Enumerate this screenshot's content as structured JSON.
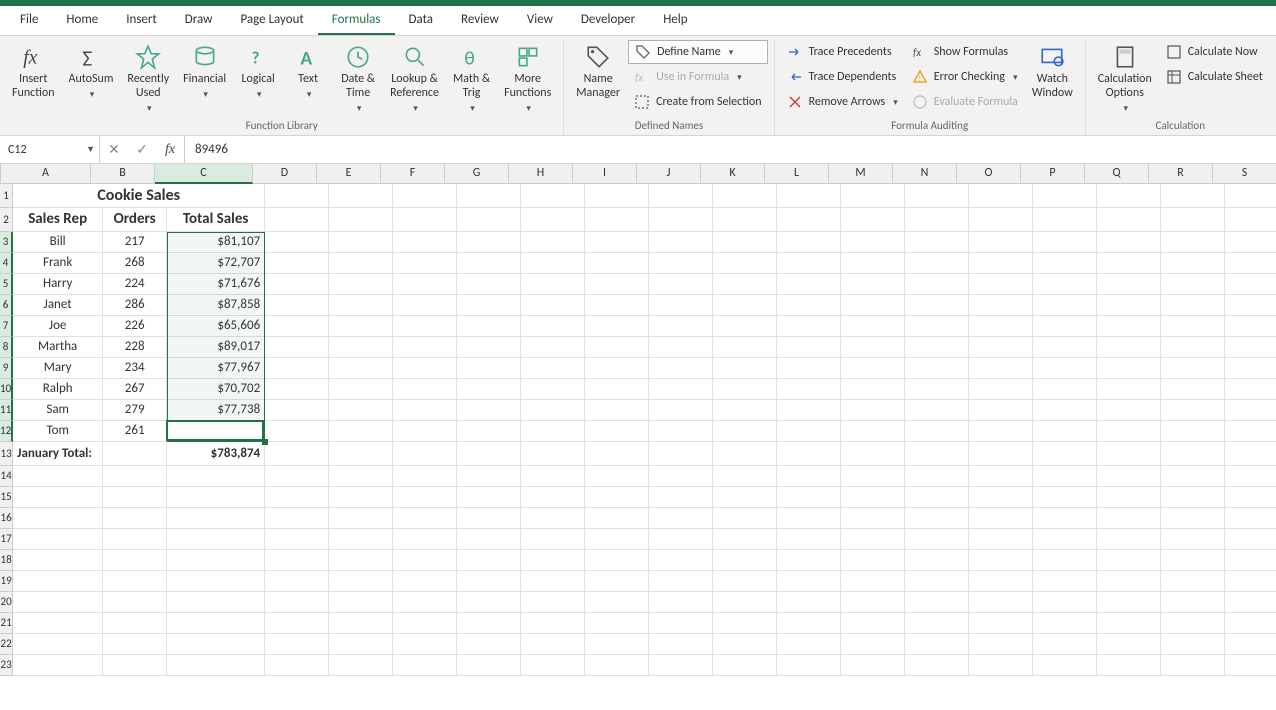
{
  "menu": {
    "tabs": [
      "File",
      "Home",
      "Insert",
      "Draw",
      "Page Layout",
      "Formulas",
      "Data",
      "Review",
      "View",
      "Developer",
      "Help"
    ],
    "active": "Formulas"
  },
  "ribbon": {
    "groups": {
      "fnlib": {
        "label": "Function Library",
        "insert_fn": "Insert\nFunction",
        "autosum": "AutoSum",
        "recent": "Recently\nUsed",
        "financial": "Financial",
        "logical": "Logical",
        "text": "Text",
        "date": "Date &\nTime",
        "lookup": "Lookup &\nReference",
        "math": "Math &\nTrig",
        "more": "More\nFunctions"
      },
      "defnames": {
        "label": "Defined Names",
        "manager": "Name\nManager",
        "define": "Define Name",
        "usein": "Use in Formula",
        "create": "Create from Selection"
      },
      "audit": {
        "label": "Formula Auditing",
        "precedents": "Trace Precedents",
        "dependents": "Trace Dependents",
        "remove": "Remove Arrows",
        "show": "Show Formulas",
        "error": "Error Checking",
        "eval": "Evaluate Formula",
        "watch": "Watch\nWindow"
      },
      "calc": {
        "label": "Calculation",
        "options": "Calculation\nOptions",
        "now": "Calculate Now",
        "sheet": "Calculate Sheet"
      }
    }
  },
  "formula_bar": {
    "name_box": "C12",
    "value": "89496"
  },
  "grid": {
    "columns": [
      "A",
      "B",
      "C",
      "D",
      "E",
      "F",
      "G",
      "H",
      "I",
      "J",
      "K",
      "L",
      "M",
      "N",
      "O",
      "P",
      "Q",
      "R",
      "S"
    ],
    "row_count": 23,
    "title": "Cookie Sales",
    "headers": {
      "a": "Sales Rep",
      "b": "Orders",
      "c": "Total Sales"
    },
    "rows": [
      {
        "rep": "Bill",
        "orders": "217",
        "total": "$81,107"
      },
      {
        "rep": "Frank",
        "orders": "268",
        "total": "$72,707"
      },
      {
        "rep": "Harry",
        "orders": "224",
        "total": "$71,676"
      },
      {
        "rep": "Janet",
        "orders": "286",
        "total": "$87,858"
      },
      {
        "rep": "Joe",
        "orders": "226",
        "total": "$65,606"
      },
      {
        "rep": "Martha",
        "orders": "228",
        "total": "$89,017"
      },
      {
        "rep": "Mary",
        "orders": "234",
        "total": "$77,967"
      },
      {
        "rep": "Ralph",
        "orders": "267",
        "total": "$70,702"
      },
      {
        "rep": "Sam",
        "orders": "279",
        "total": "$77,738"
      },
      {
        "rep": "Tom",
        "orders": "261",
        "total": "$89,496"
      }
    ],
    "total_label": "January Total:",
    "total_value": "$783,874",
    "selection": {
      "active": "C12",
      "range_top_row": 3,
      "range_bottom_row": 12,
      "range_col": "C"
    }
  }
}
